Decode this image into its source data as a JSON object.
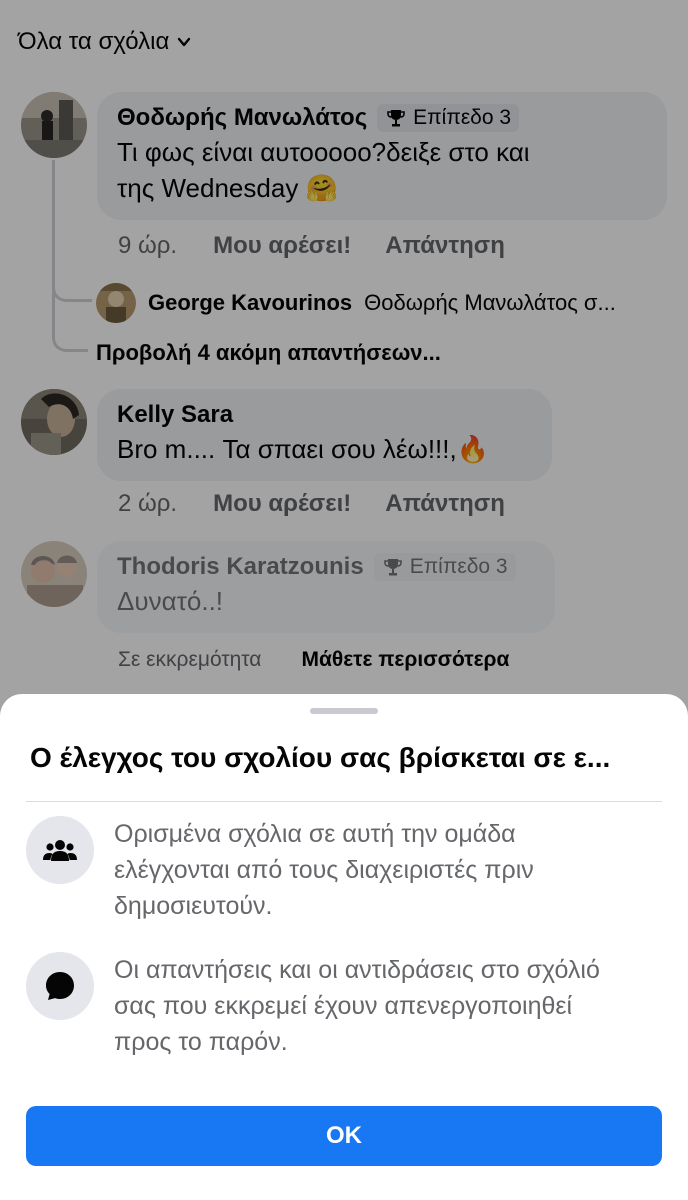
{
  "filter": {
    "label": "Όλα τα σχόλια",
    "icon": "chevron-down-icon"
  },
  "comments": [
    {
      "author": "Θοδωρής Μανωλάτος",
      "badge": "Επίπεδο 3",
      "text_line1": "Τι φως είναι αυτοοooo?δειξε στο και",
      "text_line2": "της Wednesday",
      "emoji": "🤗",
      "time": "9 ώρ.",
      "like": "Μου αρέσει!",
      "reply": "Απάντηση"
    },
    {
      "author": "Kelly Sara",
      "text": "Bro m.... Τα σπαει σου λέω!!!,",
      "emoji": "🔥",
      "time": "2 ώρ.",
      "like": "Μου αρέσει!",
      "reply": "Απάντηση"
    },
    {
      "author": "Thodoris Karatzounis",
      "badge": "Επίπεδο 3",
      "text": "Δυνατό..!",
      "status": "Σε εκκρεμότητα",
      "learn_more": "Μάθετε περισσότερα"
    }
  ],
  "reply_preview": {
    "author": "George Kavourinos",
    "text": "Θοδωρής Μανωλάτος σ..."
  },
  "more_replies": "Προβολή 4 ακόμη απαντήσεων...",
  "sheet": {
    "title": "Ο έλεγχος του σχολίου σας βρίσκεται σε ε...",
    "item1": "Ορισμένα σχόλια σε αυτή την ομάδα ελέγχονται από τους διαχειριστές πριν δημοσιευτούν.",
    "item2": "Οι απαντήσεις και οι αντιδράσεις στο σχόλιό σας που εκκρεμεί έχουν απενεργοποιηθεί προς το παρόν.",
    "ok": "OK"
  },
  "colors": {
    "accent": "#1877f2",
    "overlay": "rgba(0,0,0,0.36)",
    "bubble": "#f0f2f5"
  }
}
